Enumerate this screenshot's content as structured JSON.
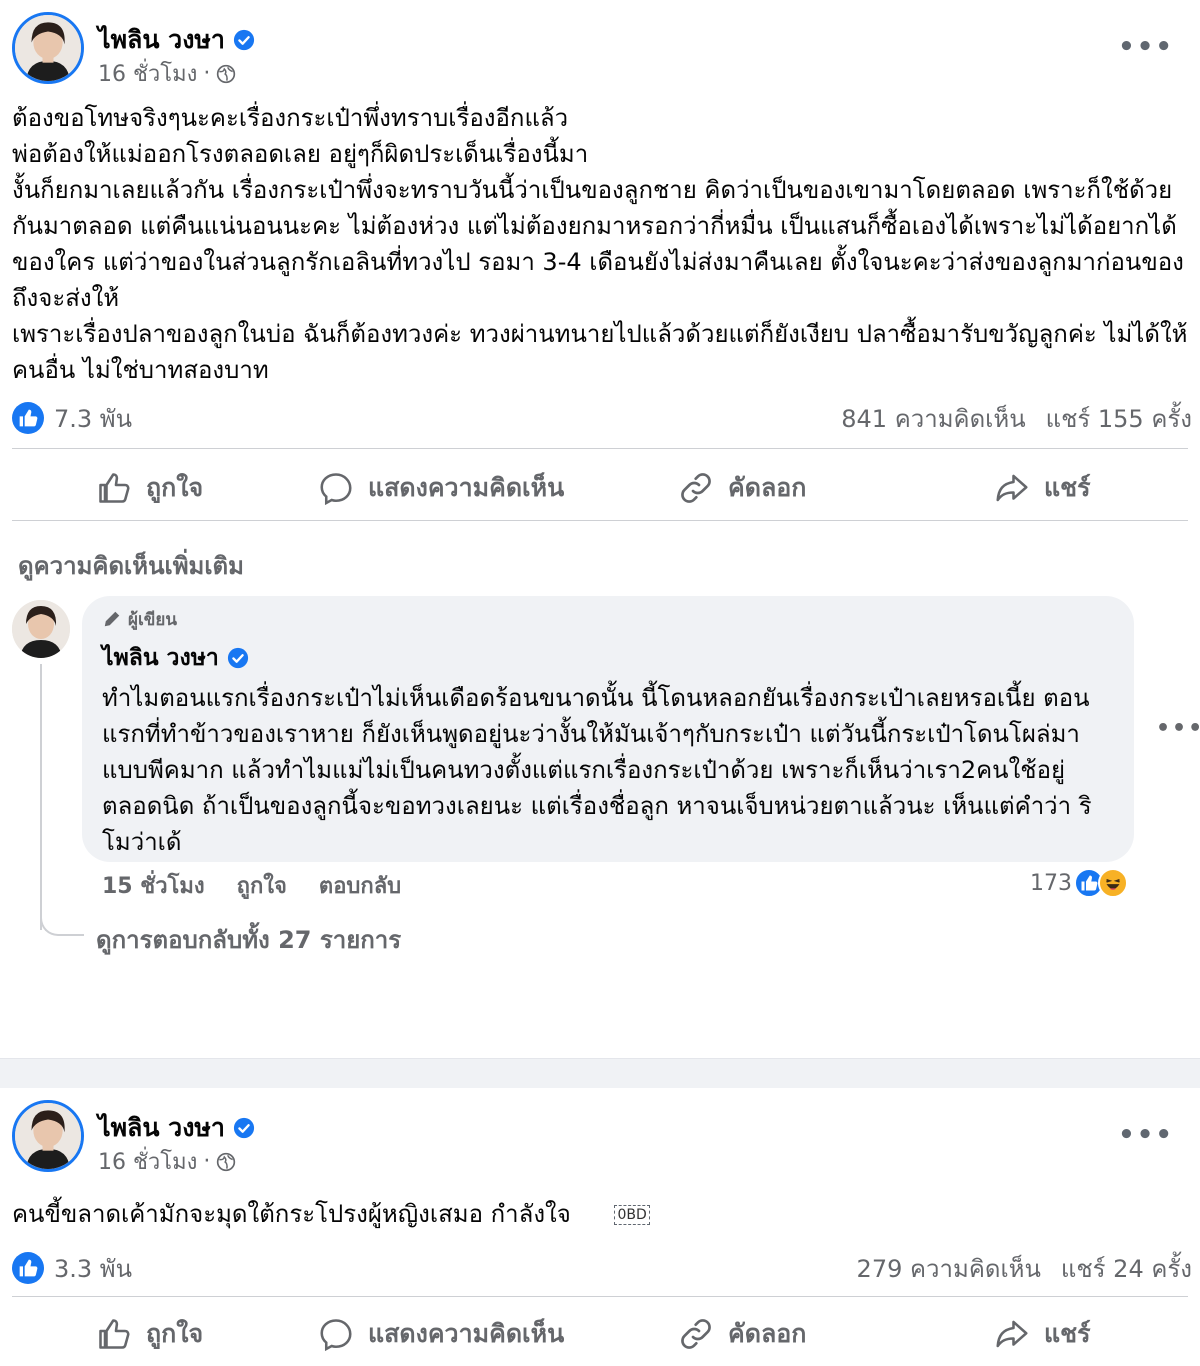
{
  "post1": {
    "author": "ไพลิน วงษา",
    "time": "16 ชั่วโมง",
    "body": [
      "ต้องขอโทษจริงๆนะคะเรื่องกระเป๋าพึ่งทราบเรื่องอีกแล้ว",
      "พ่อต้องให้แม่ออกโรงตลอดเลย อยู่ๆก็ผิดประเด็นเรื่องนี้มา",
      "งั้นก็ยกมาเลยแล้วกัน เรื่องกระเป๋าพึ่งจะทราบวันนี้ว่าเป็นของลูกชาย คิดว่าเป็นของเขามาโดยตลอด เพราะก็ใช้ด้วยกันมาตลอด แต่คืนแน่นอนนะคะ ไม่ต้องห่วง แต่ไม่ต้องยกมาหรอกว่ากี่หมื่น เป็นแสนก็ซื้อเองได้เพราะไม่ได้อยากได้ของใคร แต่ว่าของในส่วนลูกรักเอลินที่ทวงไป รอมา 3-4 เดือนยังไม่ส่งมาคืนเลย ตั้งใจนะคะว่าส่งของลูกมาก่อนของถึงจะส่งให้",
      "เพราะเรื่องปลาของลูกในบ่อ ฉันก็ต้องทวงค่ะ ทวงผ่านทนายไปแล้วด้วยแต่ก็ยังเงียบ ปลาซื้อมารับขวัญลูกค่ะ ไม่ได้ให้คนอื่น ไม่ใช่บาทสองบาท"
    ],
    "reactions": "7.3 พัน",
    "comments": "841 ความคิดเห็น",
    "shares": "แชร์ 155 ครั้ง"
  },
  "actions": {
    "like": "ถูกใจ",
    "comment": "แสดงความคิดเห็น",
    "copy": "คัดลอก",
    "share": "แชร์"
  },
  "more_comments": "ดูความคิดเห็นเพิ่มเติม",
  "comment": {
    "author_tag": "ผู้เขียน",
    "author": "ไพลิน วงษา",
    "text": "ทำไมตอนแรกเรื่องกระเป๋าไม่เห็นเดือดร้อนขนาดนั้น นี้โดนหลอกยันเรื่องกระเป๋าเลยหรอเนี้ย ตอนแรกที่ทำข้าวของเราหาย ก็ยังเห็นพูดอยู่นะว่างั้นให้มันเจ้าๆกับกระเป๋า แต่วันนี้กระเป๋าโดนโผล่มาแบบพีคมาก แล้วทำไมแม่ไม่เป็นคนทวงตั้งแต่แรกเรื่องกระเป๋าด้วย เพราะก็เห็นว่าเรา2คนใช้อยู่ตลอดนิด ถ้าเป็นของลูกนี้จะขอทวงเลยนะ แต่เรื่องชื่อลูก หาจนเจ็บหน่วยตาแล้วนะ เห็นแต่คำว่า ริโมว่าเด้",
    "time": "15 ชั่วโมง",
    "like": "ถูกใจ",
    "reply": "ตอบกลับ",
    "reaction_count": "173",
    "view_replies": "ดูการตอบกลับทั้ง 27 รายการ"
  },
  "post2": {
    "author": "ไพลิน วงษา",
    "time": "16 ชั่วโมง",
    "body": "คนขี้ขลาดเค้ามักจะมุดใต้กระโปรงผู้หญิงเสมอ  กำลังใจ",
    "emoji_placeholder": "0BD",
    "reactions": "3.3 พัน",
    "comments": "279 ความคิดเห็น",
    "shares": "แชร์ 24 ครั้ง"
  },
  "colors": {
    "accent": "#1877f2",
    "secondary_text": "#65676b",
    "bubble": "#f0f2f5"
  }
}
